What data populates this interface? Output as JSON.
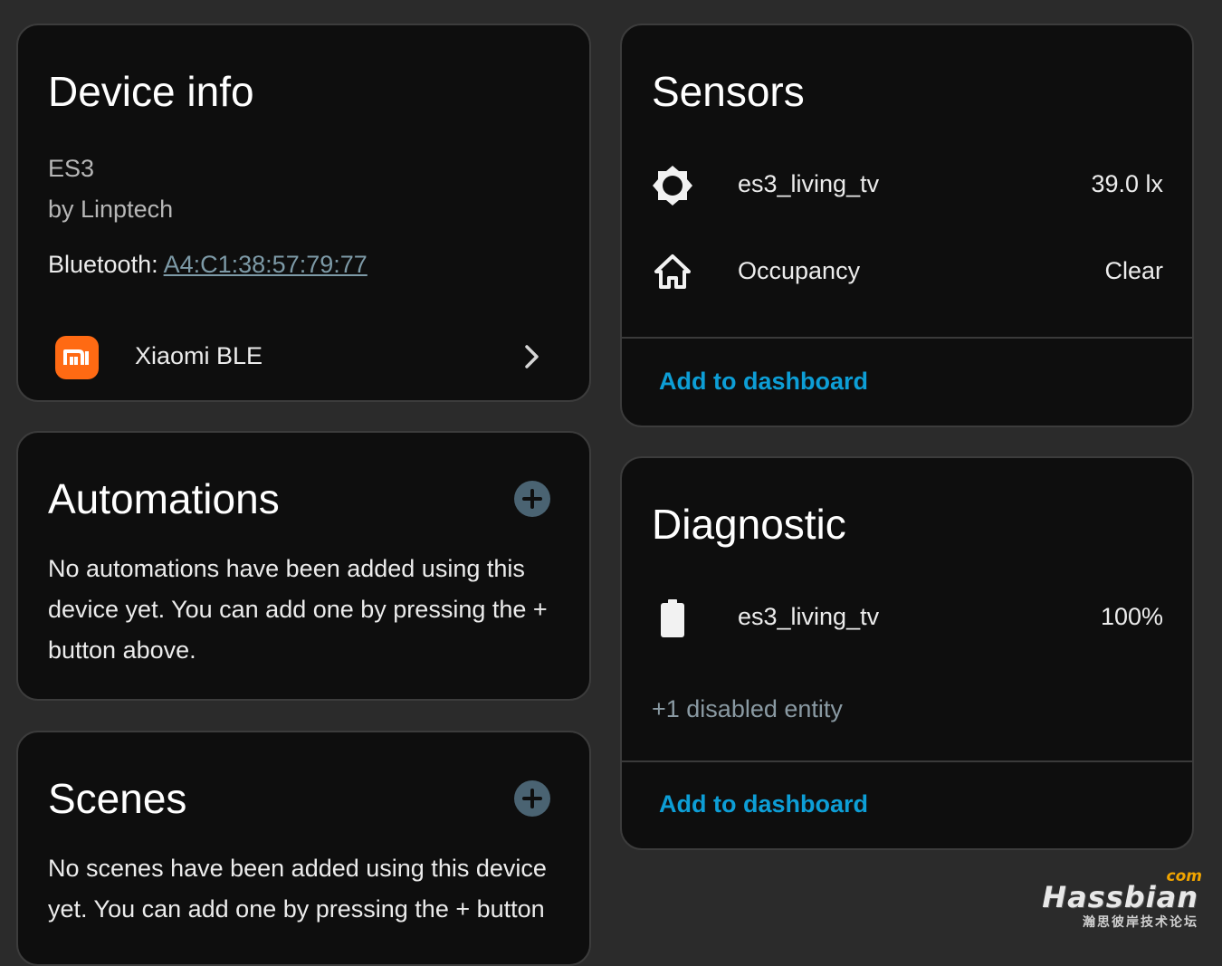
{
  "device_info": {
    "title": "Device info",
    "model": "ES3",
    "manufacturer": "by Linptech",
    "connection_label": "Bluetooth:",
    "connection_value": "A4:C1:38:57:79:77",
    "integration": {
      "name": "Xiaomi BLE",
      "icon": "xiaomi-mi-logo",
      "chevron_icon": "chevron-right-icon"
    }
  },
  "automations": {
    "title": "Automations",
    "empty_text": "No automations have been added using this device yet. You can add one by pressing the + button above.",
    "add_icon": "plus-circle-icon"
  },
  "scenes": {
    "title": "Scenes",
    "empty_text": "No scenes have been added using this device yet. You can add one by pressing the + button",
    "add_icon": "plus-circle-icon"
  },
  "sensors": {
    "title": "Sensors",
    "entities": [
      {
        "icon": "brightness-icon",
        "name": "es3_living_tv",
        "state": "39.0 lx"
      },
      {
        "icon": "home-outline-icon",
        "name": "Occupancy",
        "state": "Clear"
      }
    ],
    "action_label": "Add to dashboard"
  },
  "diagnostic": {
    "title": "Diagnostic",
    "entities": [
      {
        "icon": "battery-icon",
        "name": "es3_living_tv",
        "state": "100%"
      }
    ],
    "disabled_text": "+1 disabled entity",
    "action_label": "Add to dashboard"
  },
  "watermark": {
    "brand": "Hassbian",
    "suffix": "com",
    "subtitle": "瀚思彼岸技术论坛"
  },
  "colors": {
    "background": "#2b2b2b",
    "card": "#0e0e0e",
    "accent": "#0d9ed6",
    "xiaomi_orange": "#ff6a13",
    "plus_button": "#4a6372"
  }
}
